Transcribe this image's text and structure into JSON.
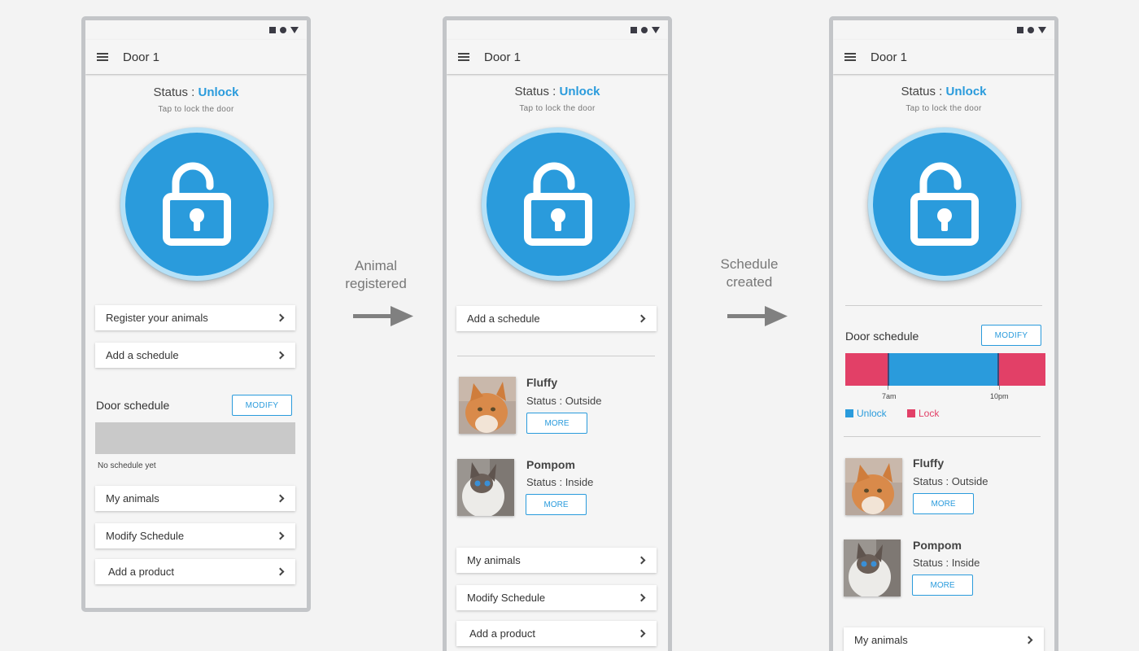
{
  "colors": {
    "accent": "#2a9bdc",
    "lock": "#e24067",
    "unlock": "#2a9bdc"
  },
  "steps": [
    {
      "label_line1": "Animal",
      "label_line2": "registered"
    },
    {
      "label_line1": "Schedule",
      "label_line2": "created"
    }
  ],
  "app": {
    "title": "Door 1",
    "status_label": "Status : ",
    "status_value": "Unlock",
    "hint": "Tap to lock the door",
    "lock_icon": "unlocked-padlock-icon"
  },
  "screen1": {
    "cards_top": [
      "Register your animals",
      "Add a schedule"
    ],
    "schedule_title": "Door schedule",
    "modify_label": "MODIFY",
    "empty_text": "No schedule yet",
    "cards_bottom": [
      "My animals",
      "Modify Schedule",
      "Add a product"
    ]
  },
  "screen2": {
    "cards_top": [
      "Add a schedule"
    ],
    "cards_bottom": [
      "My animals",
      "Modify Schedule",
      "Add a product"
    ]
  },
  "screen3": {
    "schedule_title": "Door schedule",
    "modify_label": "MODIFY",
    "schedule": {
      "segments": [
        {
          "state": "Lock",
          "from_fraction": 0.0,
          "to_fraction": 0.21
        },
        {
          "state": "Unlock",
          "from_fraction": 0.21,
          "to_fraction": 0.77
        },
        {
          "state": "Lock",
          "from_fraction": 0.77,
          "to_fraction": 1.0
        }
      ],
      "ticks": [
        "7am",
        "10pm"
      ],
      "legend": [
        "Unlock",
        "Lock"
      ]
    },
    "cards_bottom": [
      "My animals"
    ]
  },
  "pets": [
    {
      "name": "Fluffy",
      "status": "Status : Outside",
      "more_label": "MORE",
      "photo": "orange-cat-photo"
    },
    {
      "name": "Pompom",
      "status": "Status : Inside",
      "more_label": "MORE",
      "photo": "ragdoll-cat-photo"
    }
  ]
}
